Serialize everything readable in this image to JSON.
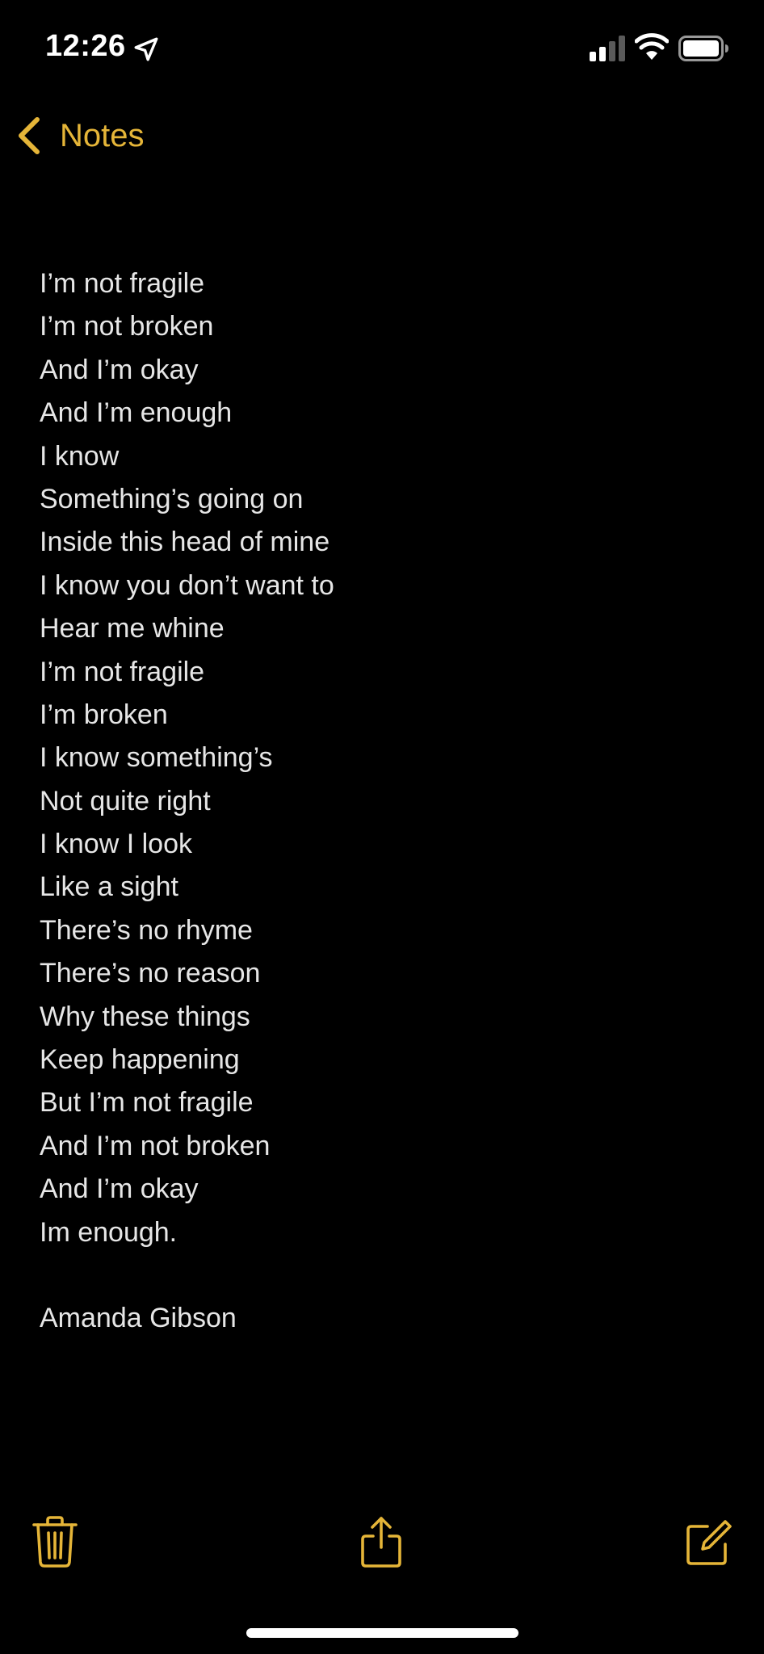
{
  "status_bar": {
    "time": "12:26",
    "icons": [
      "location-arrow-icon",
      "cellular-signal-icon",
      "wifi-icon",
      "battery-icon"
    ]
  },
  "nav": {
    "back_label": "Notes",
    "back_icon": "chevron-left-icon"
  },
  "colors": {
    "accent": "#e5b538",
    "background": "#000000",
    "text": "#e6e6e6"
  },
  "note": {
    "lines": [
      "I’m not fragile",
      "I’m not broken",
      "And I’m okay",
      "And I’m enough",
      "I know",
      "Something’s going on",
      "Inside this head of mine",
      "I know you don’t want to",
      "Hear me whine",
      "I’m not fragile",
      "I’m broken",
      "I know something’s",
      "Not quite right",
      "I know I look",
      "Like a sight",
      "There’s no rhyme",
      "There’s no reason",
      "Why these things",
      "Keep happening",
      "But I’m not fragile",
      "And I’m not broken",
      "And I’m okay",
      "Im enough."
    ],
    "signature": "Amanda Gibson"
  },
  "toolbar": {
    "icons": [
      "trash-icon",
      "share-icon",
      "compose-icon"
    ]
  }
}
